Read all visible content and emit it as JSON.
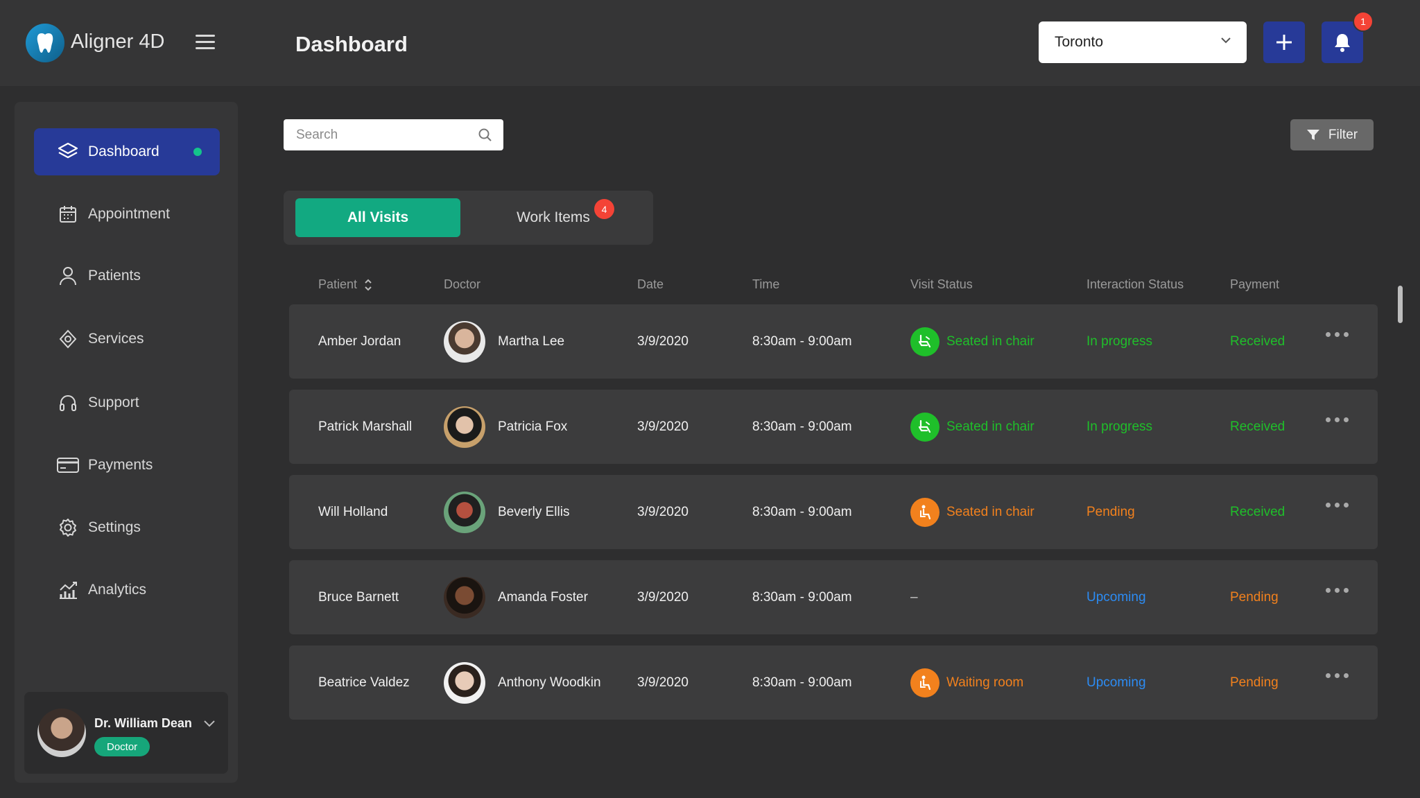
{
  "app": {
    "name": "Aligner 4D"
  },
  "header": {
    "title": "Dashboard",
    "location": "Toronto",
    "notification_count": "1"
  },
  "colors": {
    "accent_blue": "#273a98",
    "accent_green": "#12a981",
    "status_green": "#1fbf2a",
    "status_orange": "#f2811d",
    "status_blue": "#2c8cf4",
    "badge_red": "#f44336"
  },
  "sidebar": {
    "items": [
      {
        "label": "Dashboard",
        "icon": "layers-icon"
      },
      {
        "label": "Appointment",
        "icon": "calendar-icon"
      },
      {
        "label": "Patients",
        "icon": "user-icon"
      },
      {
        "label": "Services",
        "icon": "services-icon"
      },
      {
        "label": "Support",
        "icon": "headset-icon"
      },
      {
        "label": "Payments",
        "icon": "credit-card-icon"
      },
      {
        "label": "Settings",
        "icon": "gear-icon"
      },
      {
        "label": "Analytics",
        "icon": "analytics-icon"
      }
    ],
    "user": {
      "name": "Dr. William Dean",
      "role": "Doctor"
    }
  },
  "search": {
    "placeholder": "Search"
  },
  "filter": {
    "label": "Filter"
  },
  "tabs": [
    {
      "label": "All Visits"
    },
    {
      "label": "Work Items",
      "badge": "4"
    }
  ],
  "table": {
    "columns": [
      "Patient",
      "Doctor",
      "Date",
      "Time",
      "Visit Status",
      "Interaction Status",
      "Payment"
    ],
    "rows": [
      {
        "patient": "Amber Jordan",
        "doctor": "Martha Lee",
        "date": "3/9/2020",
        "time": "8:30am - 9:00am",
        "visit_status": "Seated in chair",
        "visit_color": "green",
        "visit_icon": "dental-chair-icon",
        "interaction": "In progress",
        "interaction_color": "green",
        "payment": "Received",
        "payment_color": "green"
      },
      {
        "patient": "Patrick Marshall",
        "doctor": "Patricia Fox",
        "date": "3/9/2020",
        "time": "8:30am - 9:00am",
        "visit_status": "Seated in chair",
        "visit_color": "green",
        "visit_icon": "dental-chair-icon",
        "interaction": "In progress",
        "interaction_color": "green",
        "payment": "Received",
        "payment_color": "green"
      },
      {
        "patient": "Will Holland",
        "doctor": "Beverly Ellis",
        "date": "3/9/2020",
        "time": "8:30am - 9:00am",
        "visit_status": "Seated in chair",
        "visit_color": "orange",
        "visit_icon": "seated-person-icon",
        "interaction": "Pending",
        "interaction_color": "orange",
        "payment": "Received",
        "payment_color": "green"
      },
      {
        "patient": "Bruce Barnett",
        "doctor": "Amanda Foster",
        "date": "3/9/2020",
        "time": "8:30am - 9:00am",
        "visit_status": "–",
        "visit_color": "none",
        "visit_icon": "",
        "interaction": "Upcoming",
        "interaction_color": "blue",
        "payment": "Pending",
        "payment_color": "orange"
      },
      {
        "patient": "Beatrice Valdez",
        "doctor": "Anthony Woodkin",
        "date": "3/9/2020",
        "time": "8:30am - 9:00am",
        "visit_status": "Waiting room",
        "visit_color": "orange",
        "visit_icon": "seated-person-icon",
        "interaction": "Upcoming",
        "interaction_color": "blue",
        "payment": "Pending",
        "payment_color": "orange"
      }
    ]
  }
}
